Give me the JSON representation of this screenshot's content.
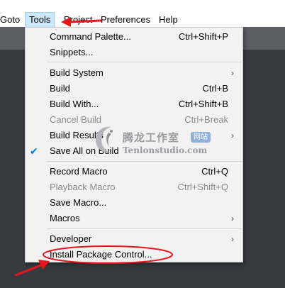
{
  "menubar": {
    "items": [
      {
        "label": "Goto"
      },
      {
        "label": "Tools"
      },
      {
        "label": "Project"
      },
      {
        "label": "Preferences"
      },
      {
        "label": "Help"
      }
    ]
  },
  "tools_menu": {
    "items": [
      {
        "label": "Command Palette...",
        "shortcut": "Ctrl+Shift+P"
      },
      {
        "label": "Snippets..."
      },
      {
        "label": "Build System"
      },
      {
        "label": "Build",
        "shortcut": "Ctrl+B"
      },
      {
        "label": "Build With...",
        "shortcut": "Ctrl+Shift+B"
      },
      {
        "label": "Cancel Build",
        "shortcut": "Ctrl+Break"
      },
      {
        "label": "Build Results"
      },
      {
        "label": "Save All on Build",
        "checked": true
      },
      {
        "label": "Record Macro",
        "shortcut": "Ctrl+Q"
      },
      {
        "label": "Playback Macro",
        "shortcut": "Ctrl+Shift+Q"
      },
      {
        "label": "Save Macro..."
      },
      {
        "label": "Macros"
      },
      {
        "label": "Developer"
      },
      {
        "label": "Install Package Control..."
      }
    ]
  },
  "icons": {
    "submenu_arrow": "›",
    "check": "✔"
  },
  "watermark": {
    "name_cn": "腾龙工作室",
    "badge": "网站",
    "name_en": "Tenlonstudio.com"
  },
  "colors": {
    "annotation_red": "#e8141b",
    "menu_bg": "#f2f2f2",
    "editor_dark": "#363a3f",
    "editor_tabbar": "#5a5d61",
    "active_highlight": "#cce8ff"
  }
}
